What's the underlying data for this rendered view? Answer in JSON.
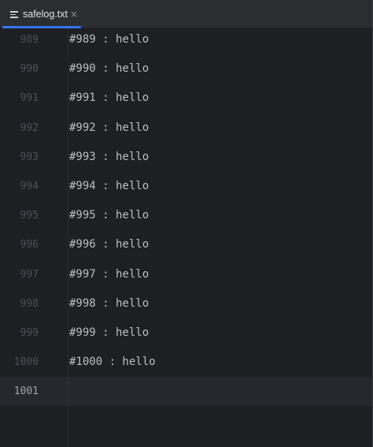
{
  "tab": {
    "filename": "safelog.txt",
    "file_icon": "text-file-icon",
    "close_glyph": "×"
  },
  "editor": {
    "lines": [
      {
        "number": "989",
        "text": "#989 : hello"
      },
      {
        "number": "990",
        "text": "#990 : hello"
      },
      {
        "number": "991",
        "text": "#991 : hello"
      },
      {
        "number": "992",
        "text": "#992 : hello"
      },
      {
        "number": "993",
        "text": "#993 : hello"
      },
      {
        "number": "994",
        "text": "#994 : hello"
      },
      {
        "number": "995",
        "text": "#995 : hello"
      },
      {
        "number": "996",
        "text": "#996 : hello"
      },
      {
        "number": "997",
        "text": "#997 : hello"
      },
      {
        "number": "998",
        "text": "#998 : hello"
      },
      {
        "number": "999",
        "text": "#999 : hello"
      },
      {
        "number": "1000",
        "text": "#1000 : hello"
      },
      {
        "number": "1001",
        "text": ""
      }
    ],
    "current_line": "1001"
  },
  "colors": {
    "background": "#1e1f22",
    "tab_bar": "#2b2d30",
    "accent": "#3574f0",
    "text": "#bcbec4",
    "line_number": "#4b5059",
    "current_line_number": "#a1a3ab",
    "current_line_highlight": "#26282e"
  }
}
